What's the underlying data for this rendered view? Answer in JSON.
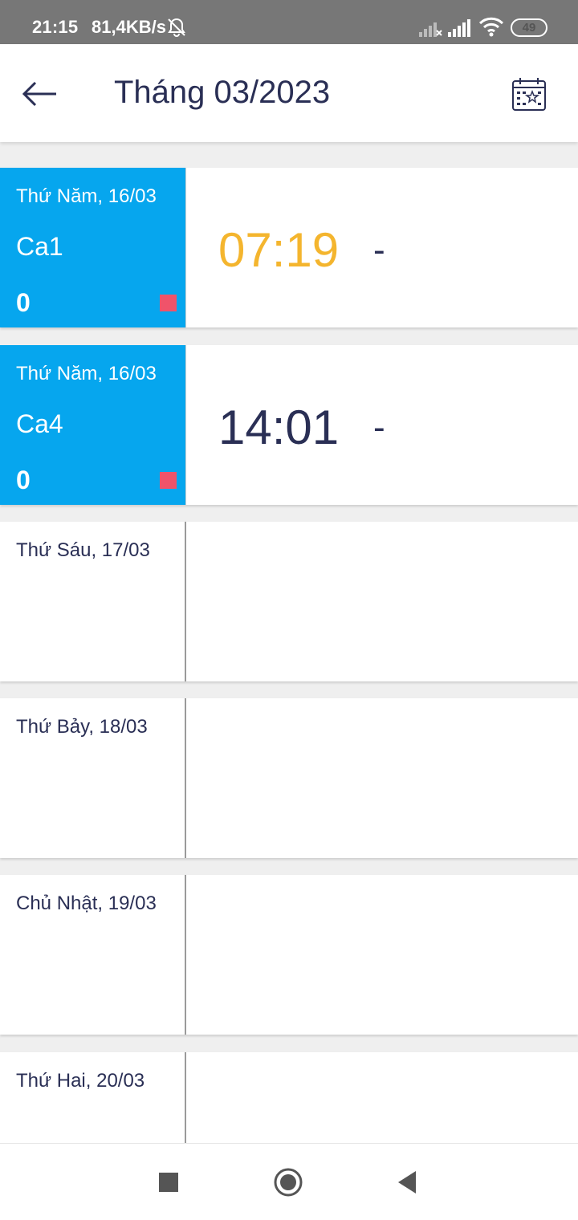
{
  "status_bar": {
    "time": "21:15",
    "speed": "81,4KB/s",
    "battery": "49"
  },
  "header": {
    "title": "Tháng 03/2023",
    "icons": {
      "back": "arrow-left-icon",
      "calendar": "calendar-star-icon"
    }
  },
  "colors": {
    "accent_blue": "#06a6ee",
    "time_orange": "#f4b52e",
    "text_navy": "#2a2f55",
    "marker_red": "#f0536a"
  },
  "rows": [
    {
      "date": "Thứ Năm, 16/03",
      "shift": "Ca1",
      "count": "0",
      "time": "07:19",
      "time_color": "#f4b52e",
      "dash": "-"
    },
    {
      "date": "Thứ Năm, 16/03",
      "shift": "Ca4",
      "count": "0",
      "time": "14:01",
      "time_color": "#2a2f55",
      "dash": "-"
    },
    {
      "date": "Thứ Sáu, 17/03"
    },
    {
      "date": "Thứ Bảy, 18/03"
    },
    {
      "date": "Chủ Nhật, 19/03"
    },
    {
      "date": "Thứ Hai, 20/03"
    }
  ],
  "nav_bar": {
    "icons": [
      "recents-square-icon",
      "home-circle-icon",
      "back-triangle-icon"
    ]
  }
}
